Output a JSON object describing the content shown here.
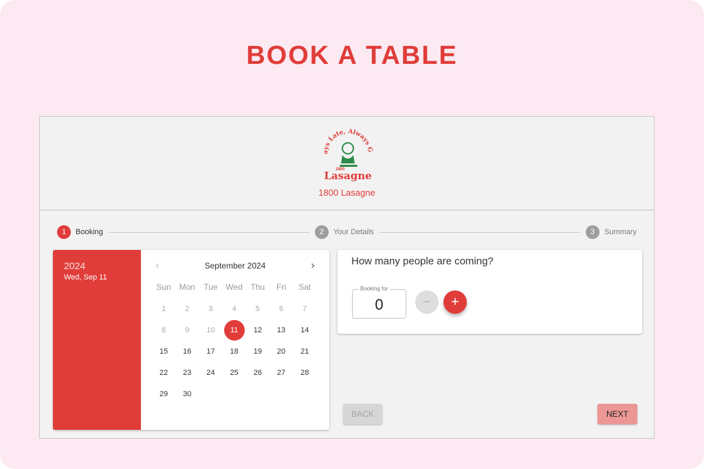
{
  "page": {
    "title": "BOOK A TABLE"
  },
  "restaurant": {
    "name": "1800 Lasagne",
    "logo": {
      "arc_text": "Always Late, Always Great",
      "brand_top": "1800",
      "brand": "Lasagne"
    }
  },
  "stepper": {
    "steps": [
      {
        "number": "1",
        "label": "Booking",
        "state": "active"
      },
      {
        "number": "2",
        "label": "Your Details",
        "state": "inactive"
      },
      {
        "number": "3",
        "label": "Summary",
        "state": "inactive"
      }
    ]
  },
  "calendar": {
    "year": "2024",
    "selected_date_label": "Wed, Sep 11",
    "month_label": "September 2024",
    "prev_icon": "chevron-left-icon",
    "next_icon": "chevron-right-icon",
    "weekdays": [
      "Sun",
      "Mon",
      "Tue",
      "Wed",
      "Thu",
      "Fri",
      "Sat"
    ],
    "days": [
      "1",
      "2",
      "3",
      "4",
      "5",
      "6",
      "7",
      "8",
      "9",
      "10",
      "11",
      "12",
      "13",
      "14",
      "15",
      "16",
      "17",
      "18",
      "19",
      "20",
      "21",
      "22",
      "23",
      "24",
      "25",
      "26",
      "27",
      "28",
      "29",
      "30"
    ],
    "selected_day": "11",
    "disabled_before": 11
  },
  "guests": {
    "question": "How many people are coming?",
    "field_label": "Booking for",
    "value": "0",
    "decrement_symbol": "−",
    "increment_symbol": "+"
  },
  "actions": {
    "back_label": "BACK",
    "next_label": "NEXT"
  },
  "colors": {
    "accent": "#e03c39",
    "background": "#fce9f1",
    "next_button": "#ec9795"
  }
}
